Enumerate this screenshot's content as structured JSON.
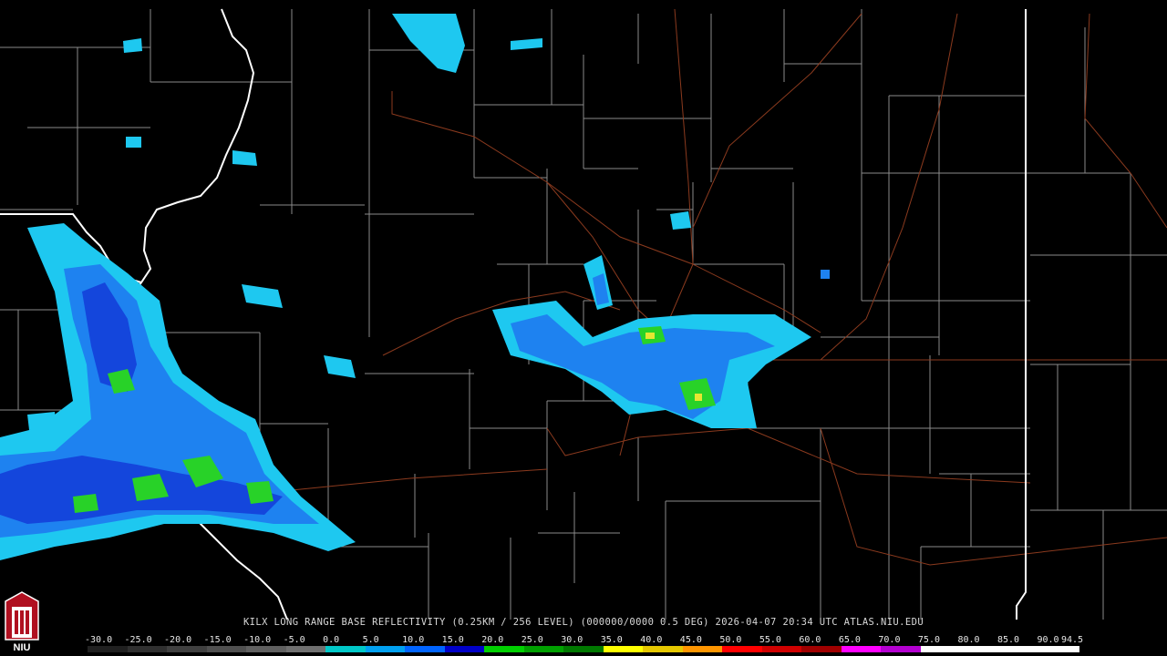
{
  "caption": "KILX LONG RANGE BASE REFLECTIVITY (0.25KM / 256 LEVEL) (000000/0000 0.5 DEG) 2026-04-07 20:34 UTC  ATLAS.NIU.EDU",
  "logo": {
    "name": "NIU"
  },
  "scale": {
    "labels": [
      "-30.0",
      "-25.0",
      "-20.0",
      "-15.0",
      "-10.0",
      "-5.0",
      "0.0",
      "5.0",
      "10.0",
      "15.0",
      "20.0",
      "25.0",
      "30.0",
      "35.0",
      "40.0",
      "45.0",
      "50.0",
      "55.0",
      "60.0",
      "65.0",
      "70.0",
      "75.0",
      "80.0",
      "85.0",
      "90.0",
      "94.5"
    ],
    "colors": [
      "#202020",
      "#303030",
      "#404040",
      "#505050",
      "#606060",
      "#707070",
      "#00c8c8",
      "#00a0f0",
      "#0064ff",
      "#0000c8",
      "#00d000",
      "#00a000",
      "#007800",
      "#ffff00",
      "#e6c800",
      "#ff9600",
      "#ff0000",
      "#d00000",
      "#a00000",
      "#ff00ff",
      "#b400d0",
      "#ffffff",
      "#ffffff",
      "#ffffff",
      "#ffffff"
    ]
  },
  "map": {
    "background": "#000000",
    "county_line_color": "#8a8a8a",
    "state_line_color": "#ffffff",
    "highway_color": "#8b3a1e",
    "echo_colors": {
      "light": "#1ec8f0",
      "medium": "#1e82f0",
      "heavy": "#1446dc",
      "strong": "#28d228",
      "yellow": "#e6e632"
    }
  }
}
